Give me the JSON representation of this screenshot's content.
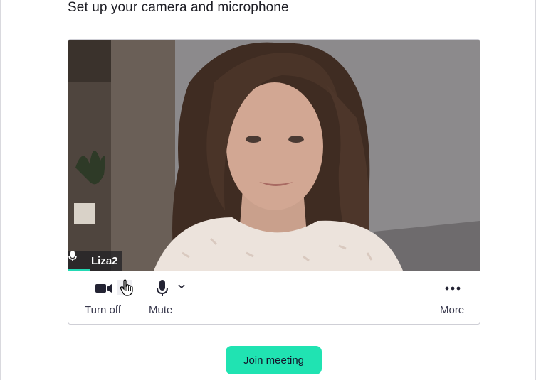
{
  "header": {
    "title": "Set up your camera and microphone"
  },
  "preview": {
    "participant_name": "Liza2",
    "accent_color": "#23d9b4"
  },
  "controls": {
    "camera": {
      "label": "Turn off",
      "icon": "video-camera-icon"
    },
    "mic": {
      "label": "Mute",
      "icon": "microphone-icon"
    },
    "more": {
      "label": "More",
      "icon": "more-dots-icon"
    }
  },
  "join": {
    "label": "Join meeting",
    "color": "#20e3b2"
  }
}
